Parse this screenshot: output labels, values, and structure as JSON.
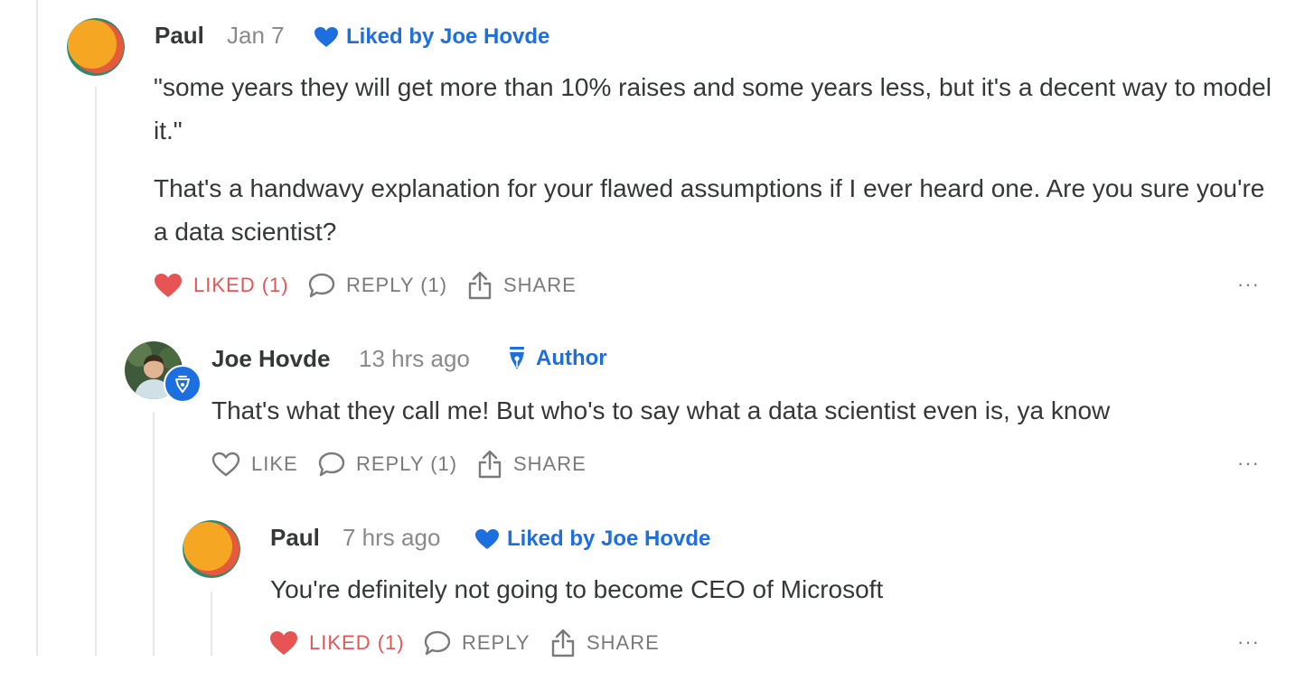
{
  "comments": [
    {
      "author": "Paul",
      "time": "Jan 7",
      "liked_by": "Liked by Joe Hovde",
      "paragraphs": [
        "\"some years they will get more than 10% raises and some years less, but it's a decent way to model it.\"",
        "That's a handwavy explanation for your flawed assumptions if I ever heard one. Are you sure you're a data scientist?"
      ],
      "like_label": "LIKED (1)",
      "reply_label": "REPLY (1)",
      "share_label": "SHARE",
      "more_label": "···"
    },
    {
      "author": "Joe Hovde",
      "time": "13 hrs ago",
      "badge": "Author",
      "paragraphs": [
        "That's what they call me! But who's to say what a data scientist even is, ya know"
      ],
      "like_label": "LIKE",
      "reply_label": "REPLY (1)",
      "share_label": "SHARE",
      "more_label": "···"
    },
    {
      "author": "Paul",
      "time": "7 hrs ago",
      "liked_by": "Liked by Joe Hovde",
      "paragraphs": [
        "You're definitely not going to become CEO of Microsoft"
      ],
      "like_label": "LIKED (1)",
      "reply_label": "REPLY",
      "share_label": "SHARE",
      "more_label": "···"
    }
  ],
  "colors": {
    "accent_blue": "#1d6fe0",
    "liked_red": "#e65454",
    "text": "#363737",
    "muted": "#8a8a8a"
  }
}
